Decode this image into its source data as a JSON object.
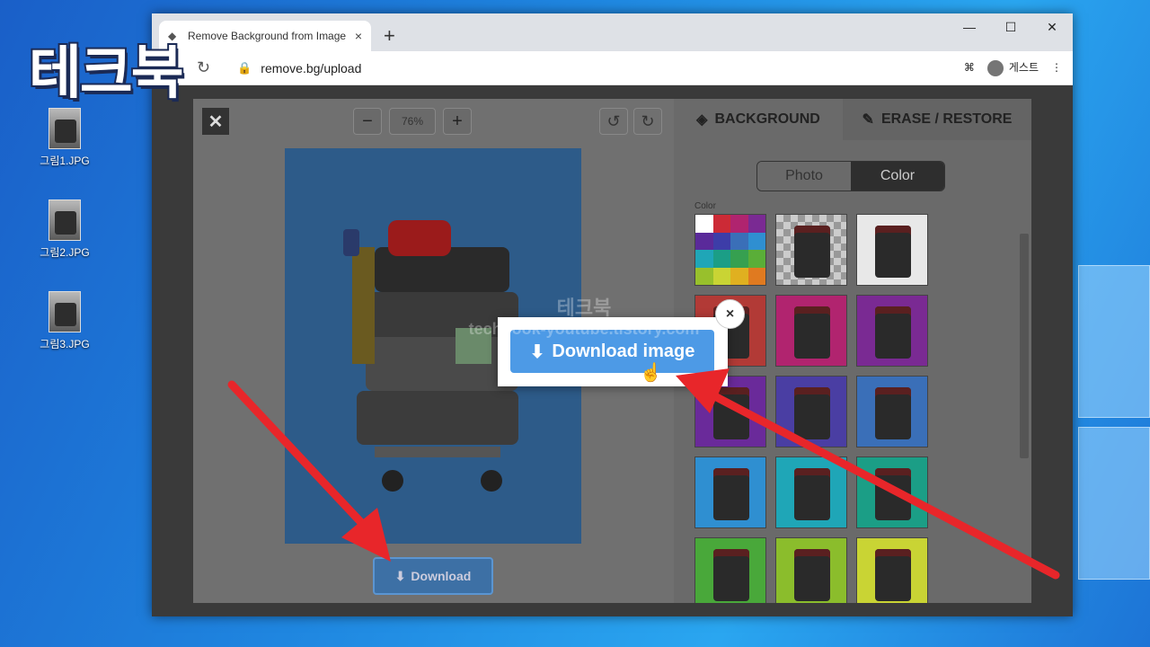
{
  "brand": "테크북",
  "desktop_icons": [
    {
      "label": "그림1.JPG"
    },
    {
      "label": "그림2.JPG"
    },
    {
      "label": "그림3.JPG"
    }
  ],
  "browser": {
    "tab_title": "Remove Background from Image",
    "url": "remove.bg/upload",
    "profile_label": "게스트",
    "new_tab": "+",
    "close_tab": "×"
  },
  "editor": {
    "zoom_minus": "−",
    "zoom_value": "76%",
    "zoom_plus": "+",
    "download_small": "Download",
    "tabs": {
      "background": "BACKGROUND",
      "erase": "ERASE / RESTORE"
    },
    "segment": {
      "photo": "Photo",
      "color": "Color"
    },
    "color_label": "Color",
    "swatches": [
      "palette",
      "transparent",
      "white",
      "#b23a36",
      "#b1246f",
      "#7a2a93",
      "#6a2a9a",
      "#4a3ea3",
      "#3a6fb8",
      "#2f8fd1",
      "#1fa6b7",
      "#1b9e86",
      "#49a83a",
      "#8bbd2c",
      "#c9d434"
    ],
    "palette": [
      "#ffffff",
      "#cc2a36",
      "#b0246f",
      "#7a2a93",
      "#5a2a9a",
      "#3d3da8",
      "#3a6fb8",
      "#2f8fd1",
      "#1fa6b7",
      "#1b9e86",
      "#36a050",
      "#5aae38",
      "#98c02c",
      "#c9d434",
      "#e0b020",
      "#e07a20"
    ]
  },
  "popup": {
    "button_label": "Download image",
    "close": "×"
  },
  "watermark": {
    "line1": "테크북",
    "line2": "techbook-youtube.tistory.com"
  },
  "colors": {
    "arrow": "#e8262a",
    "accent": "#4d9ae6"
  }
}
